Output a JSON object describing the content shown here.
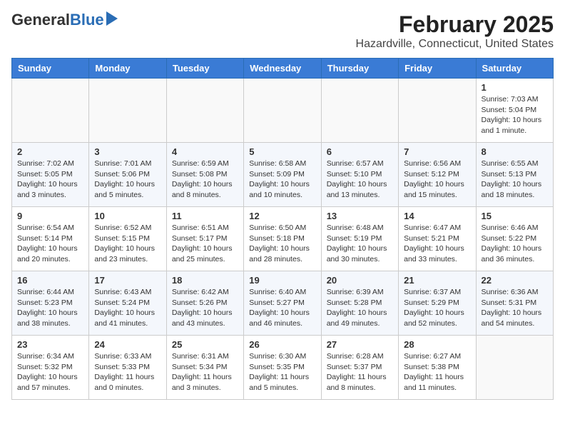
{
  "header": {
    "logo_line1": "General",
    "logo_line2": "Blue",
    "title": "February 2025",
    "subtitle": "Hazardville, Connecticut, United States"
  },
  "weekdays": [
    "Sunday",
    "Monday",
    "Tuesday",
    "Wednesday",
    "Thursday",
    "Friday",
    "Saturday"
  ],
  "weeks": [
    [
      {
        "day": "",
        "info": ""
      },
      {
        "day": "",
        "info": ""
      },
      {
        "day": "",
        "info": ""
      },
      {
        "day": "",
        "info": ""
      },
      {
        "day": "",
        "info": ""
      },
      {
        "day": "",
        "info": ""
      },
      {
        "day": "1",
        "info": "Sunrise: 7:03 AM\nSunset: 5:04 PM\nDaylight: 10 hours and 1 minute."
      }
    ],
    [
      {
        "day": "2",
        "info": "Sunrise: 7:02 AM\nSunset: 5:05 PM\nDaylight: 10 hours and 3 minutes."
      },
      {
        "day": "3",
        "info": "Sunrise: 7:01 AM\nSunset: 5:06 PM\nDaylight: 10 hours and 5 minutes."
      },
      {
        "day": "4",
        "info": "Sunrise: 6:59 AM\nSunset: 5:08 PM\nDaylight: 10 hours and 8 minutes."
      },
      {
        "day": "5",
        "info": "Sunrise: 6:58 AM\nSunset: 5:09 PM\nDaylight: 10 hours and 10 minutes."
      },
      {
        "day": "6",
        "info": "Sunrise: 6:57 AM\nSunset: 5:10 PM\nDaylight: 10 hours and 13 minutes."
      },
      {
        "day": "7",
        "info": "Sunrise: 6:56 AM\nSunset: 5:12 PM\nDaylight: 10 hours and 15 minutes."
      },
      {
        "day": "8",
        "info": "Sunrise: 6:55 AM\nSunset: 5:13 PM\nDaylight: 10 hours and 18 minutes."
      }
    ],
    [
      {
        "day": "9",
        "info": "Sunrise: 6:54 AM\nSunset: 5:14 PM\nDaylight: 10 hours and 20 minutes."
      },
      {
        "day": "10",
        "info": "Sunrise: 6:52 AM\nSunset: 5:15 PM\nDaylight: 10 hours and 23 minutes."
      },
      {
        "day": "11",
        "info": "Sunrise: 6:51 AM\nSunset: 5:17 PM\nDaylight: 10 hours and 25 minutes."
      },
      {
        "day": "12",
        "info": "Sunrise: 6:50 AM\nSunset: 5:18 PM\nDaylight: 10 hours and 28 minutes."
      },
      {
        "day": "13",
        "info": "Sunrise: 6:48 AM\nSunset: 5:19 PM\nDaylight: 10 hours and 30 minutes."
      },
      {
        "day": "14",
        "info": "Sunrise: 6:47 AM\nSunset: 5:21 PM\nDaylight: 10 hours and 33 minutes."
      },
      {
        "day": "15",
        "info": "Sunrise: 6:46 AM\nSunset: 5:22 PM\nDaylight: 10 hours and 36 minutes."
      }
    ],
    [
      {
        "day": "16",
        "info": "Sunrise: 6:44 AM\nSunset: 5:23 PM\nDaylight: 10 hours and 38 minutes."
      },
      {
        "day": "17",
        "info": "Sunrise: 6:43 AM\nSunset: 5:24 PM\nDaylight: 10 hours and 41 minutes."
      },
      {
        "day": "18",
        "info": "Sunrise: 6:42 AM\nSunset: 5:26 PM\nDaylight: 10 hours and 43 minutes."
      },
      {
        "day": "19",
        "info": "Sunrise: 6:40 AM\nSunset: 5:27 PM\nDaylight: 10 hours and 46 minutes."
      },
      {
        "day": "20",
        "info": "Sunrise: 6:39 AM\nSunset: 5:28 PM\nDaylight: 10 hours and 49 minutes."
      },
      {
        "day": "21",
        "info": "Sunrise: 6:37 AM\nSunset: 5:29 PM\nDaylight: 10 hours and 52 minutes."
      },
      {
        "day": "22",
        "info": "Sunrise: 6:36 AM\nSunset: 5:31 PM\nDaylight: 10 hours and 54 minutes."
      }
    ],
    [
      {
        "day": "23",
        "info": "Sunrise: 6:34 AM\nSunset: 5:32 PM\nDaylight: 10 hours and 57 minutes."
      },
      {
        "day": "24",
        "info": "Sunrise: 6:33 AM\nSunset: 5:33 PM\nDaylight: 11 hours and 0 minutes."
      },
      {
        "day": "25",
        "info": "Sunrise: 6:31 AM\nSunset: 5:34 PM\nDaylight: 11 hours and 3 minutes."
      },
      {
        "day": "26",
        "info": "Sunrise: 6:30 AM\nSunset: 5:35 PM\nDaylight: 11 hours and 5 minutes."
      },
      {
        "day": "27",
        "info": "Sunrise: 6:28 AM\nSunset: 5:37 PM\nDaylight: 11 hours and 8 minutes."
      },
      {
        "day": "28",
        "info": "Sunrise: 6:27 AM\nSunset: 5:38 PM\nDaylight: 11 hours and 11 minutes."
      },
      {
        "day": "",
        "info": ""
      }
    ]
  ]
}
